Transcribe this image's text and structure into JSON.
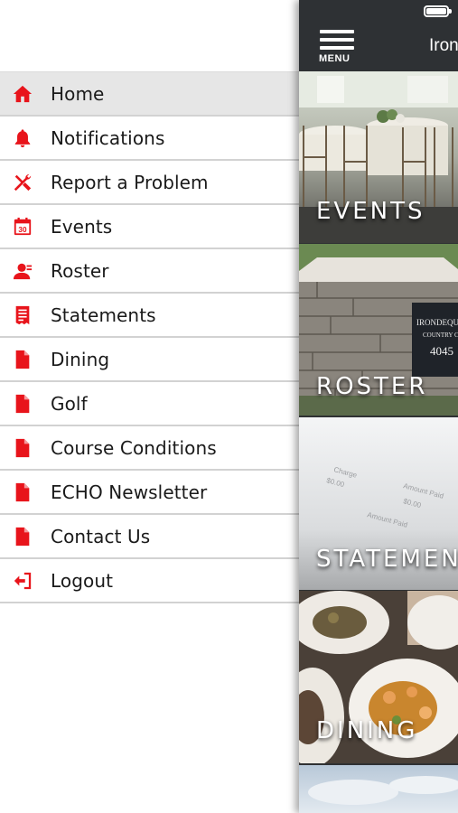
{
  "drawer": {
    "items": [
      {
        "label": "Home",
        "icon": "home-icon",
        "active": true
      },
      {
        "label": "Notifications",
        "icon": "bell-icon",
        "active": false
      },
      {
        "label": "Report a Problem",
        "icon": "tools-icon",
        "active": false
      },
      {
        "label": "Events",
        "icon": "calendar-icon",
        "active": false
      },
      {
        "label": "Roster",
        "icon": "person-icon",
        "active": false
      },
      {
        "label": "Statements",
        "icon": "statement-icon",
        "active": false
      },
      {
        "label": "Dining",
        "icon": "document-icon",
        "active": false
      },
      {
        "label": "Golf",
        "icon": "document-icon",
        "active": false
      },
      {
        "label": "Course Conditions",
        "icon": "document-icon",
        "active": false
      },
      {
        "label": "ECHO Newsletter",
        "icon": "document-icon",
        "active": false
      },
      {
        "label": "Contact Us",
        "icon": "document-icon",
        "active": false
      },
      {
        "label": "Logout",
        "icon": "logout-icon",
        "active": false
      }
    ],
    "calendar_day": "30"
  },
  "topbar": {
    "menu_label": "MENU",
    "title": "Iron"
  },
  "tiles": [
    {
      "label": "EVENTS"
    },
    {
      "label": "ROSTER"
    },
    {
      "label": "STATEMENTS"
    },
    {
      "label": "DINING"
    }
  ],
  "photo_text": {
    "sign_line1": "IRONDEQUO",
    "sign_line2": "COUNTRY CLU",
    "sign_number": "4045",
    "charge": "Charge",
    "amount_paid": "Amount Paid",
    "amount_paid_2": "Amount Paid",
    "amount": "$0.00",
    "amount_2": "$0.00"
  },
  "colors": {
    "accent": "#e8141b",
    "topbar": "#2e3134",
    "active_row": "#e6e6e6"
  }
}
